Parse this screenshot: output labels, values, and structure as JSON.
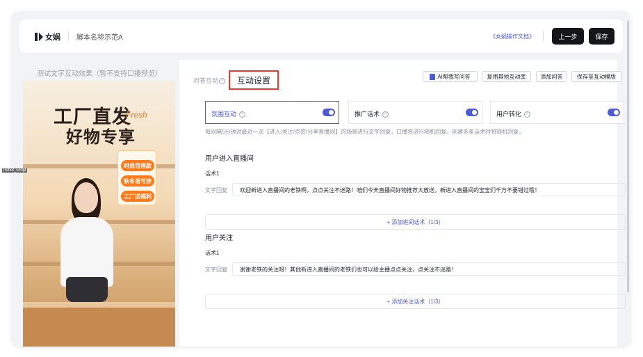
{
  "header": {
    "logo_text": "女娲",
    "script_name": "脚本名称示范A",
    "doc_link": "《女娲操作文档》",
    "prev_label": "上一步",
    "save_label": "保存"
  },
  "preview": {
    "title": "测试文字互动效果（暂不支持口播预览）",
    "poster_title_1": "工厂直发",
    "poster_fresh": "Fresh",
    "poster_title_2": "好物专享",
    "badges": [
      "时尚百搭款",
      "秋冬皆可穿",
      "工厂送福利"
    ],
    "overlay_label": "ITshot_script"
  },
  "tabs": {
    "inactive": "问答互动",
    "active": "互动设置"
  },
  "toolbar": {
    "ai_write": "AI帮我写问答",
    "reuse": "复用其他互动库",
    "add_qa": "添加问答",
    "save_template": "保存至互动模版"
  },
  "modes": [
    {
      "label": "氛围互动",
      "enabled": true
    },
    {
      "label": "推广话术",
      "enabled": true
    },
    {
      "label": "用户转化",
      "enabled": true
    }
  ],
  "hint": "每间隔5分钟对最近一次【进入/关注/点赞/分享直播间】的场景进行文字回复，口播将进行随机回复。创建多条话术时将随机回复。",
  "sections": [
    {
      "title": "用户进入直播间",
      "talk_label": "话术1",
      "reply_label": "文字回复",
      "reply_text": "欢迎新进入直播间的老铁啊，点点关注不迷路！咱们今天直播间好物推荐大放送，新进入直播间的宝宝们千万不要错过哦！",
      "add_label": "+ 添加进间话术（1/3）"
    },
    {
      "title": "用户关注",
      "talk_label": "话术1",
      "reply_label": "文字回复",
      "reply_text": "谢谢老铁的关注呀！其他新进入直播间的老铁们也可以给主播点点关注，点关注不迷路！",
      "add_label": "+ 添加关注话术（1/3）"
    }
  ],
  "colors": {
    "accent": "#4e5bd6",
    "dark_button": "#15161a",
    "highlight_border": "#e53935",
    "badge": "#ff7a1a"
  }
}
